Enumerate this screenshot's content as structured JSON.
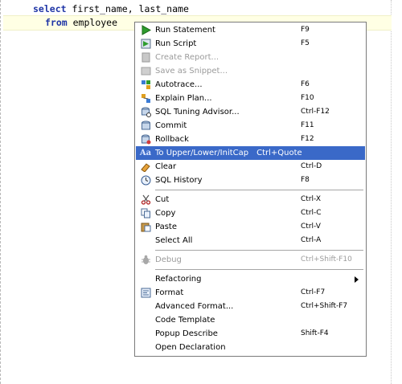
{
  "editor": {
    "line1": {
      "keyword": "select",
      "rest": " first_name, last_name"
    },
    "line2": {
      "keyword": "from",
      "rest": " employee"
    }
  },
  "menu": {
    "items": [
      {
        "icon": "play-icon",
        "label": "Run Statement",
        "shortcut": "F9"
      },
      {
        "icon": "run-script-icon",
        "label": "Run Script",
        "shortcut": "F5"
      },
      {
        "icon": "report-icon",
        "label": "Create Report...",
        "shortcut": ""
      },
      {
        "icon": "snippet-icon",
        "label": "Save as Snippet...",
        "shortcut": ""
      },
      {
        "icon": "autotrace-icon",
        "label": "Autotrace...",
        "shortcut": "F6"
      },
      {
        "icon": "explain-plan-icon",
        "label": "Explain Plan...",
        "shortcut": "F10"
      },
      {
        "icon": "tuning-advisor-icon",
        "label": "SQL Tuning Advisor...",
        "shortcut": "Ctrl-F12"
      },
      {
        "icon": "commit-icon",
        "label": "Commit",
        "shortcut": "F11"
      },
      {
        "icon": "rollback-icon",
        "label": "Rollback",
        "shortcut": "F12"
      },
      {
        "icon": "case-icon",
        "label": "To Upper/Lower/InitCap",
        "shortcut": "Ctrl+Quote"
      },
      {
        "icon": "eraser-icon",
        "label": "Clear",
        "shortcut": "Ctrl-D"
      },
      {
        "icon": "history-icon",
        "label": "SQL History",
        "shortcut": "F8"
      },
      {
        "icon": "scissors-icon",
        "label": "Cut",
        "shortcut": "Ctrl-X"
      },
      {
        "icon": "copy-icon",
        "label": "Copy",
        "shortcut": "Ctrl-C"
      },
      {
        "icon": "paste-icon",
        "label": "Paste",
        "shortcut": "Ctrl-V"
      },
      {
        "icon": "",
        "label": "Select All",
        "shortcut": "Ctrl-A"
      },
      {
        "icon": "bug-icon",
        "label": "Debug",
        "shortcut": "Ctrl+Shift-F10"
      },
      {
        "icon": "",
        "label": "Refactoring",
        "shortcut": ""
      },
      {
        "icon": "format-icon",
        "label": "Format",
        "shortcut": "Ctrl-F7"
      },
      {
        "icon": "",
        "label": "Advanced Format...",
        "shortcut": "Ctrl+Shift-F7"
      },
      {
        "icon": "",
        "label": "Code Template",
        "shortcut": ""
      },
      {
        "icon": "",
        "label": "Popup Describe",
        "shortcut": "Shift-F4"
      },
      {
        "icon": "",
        "label": "Open Declaration",
        "shortcut": ""
      }
    ]
  },
  "colors": {
    "selection": "#3a69c8",
    "keyword": "#1f35a6",
    "current_line": "#ffffe4",
    "disabled_text": "#9b9b9b"
  }
}
